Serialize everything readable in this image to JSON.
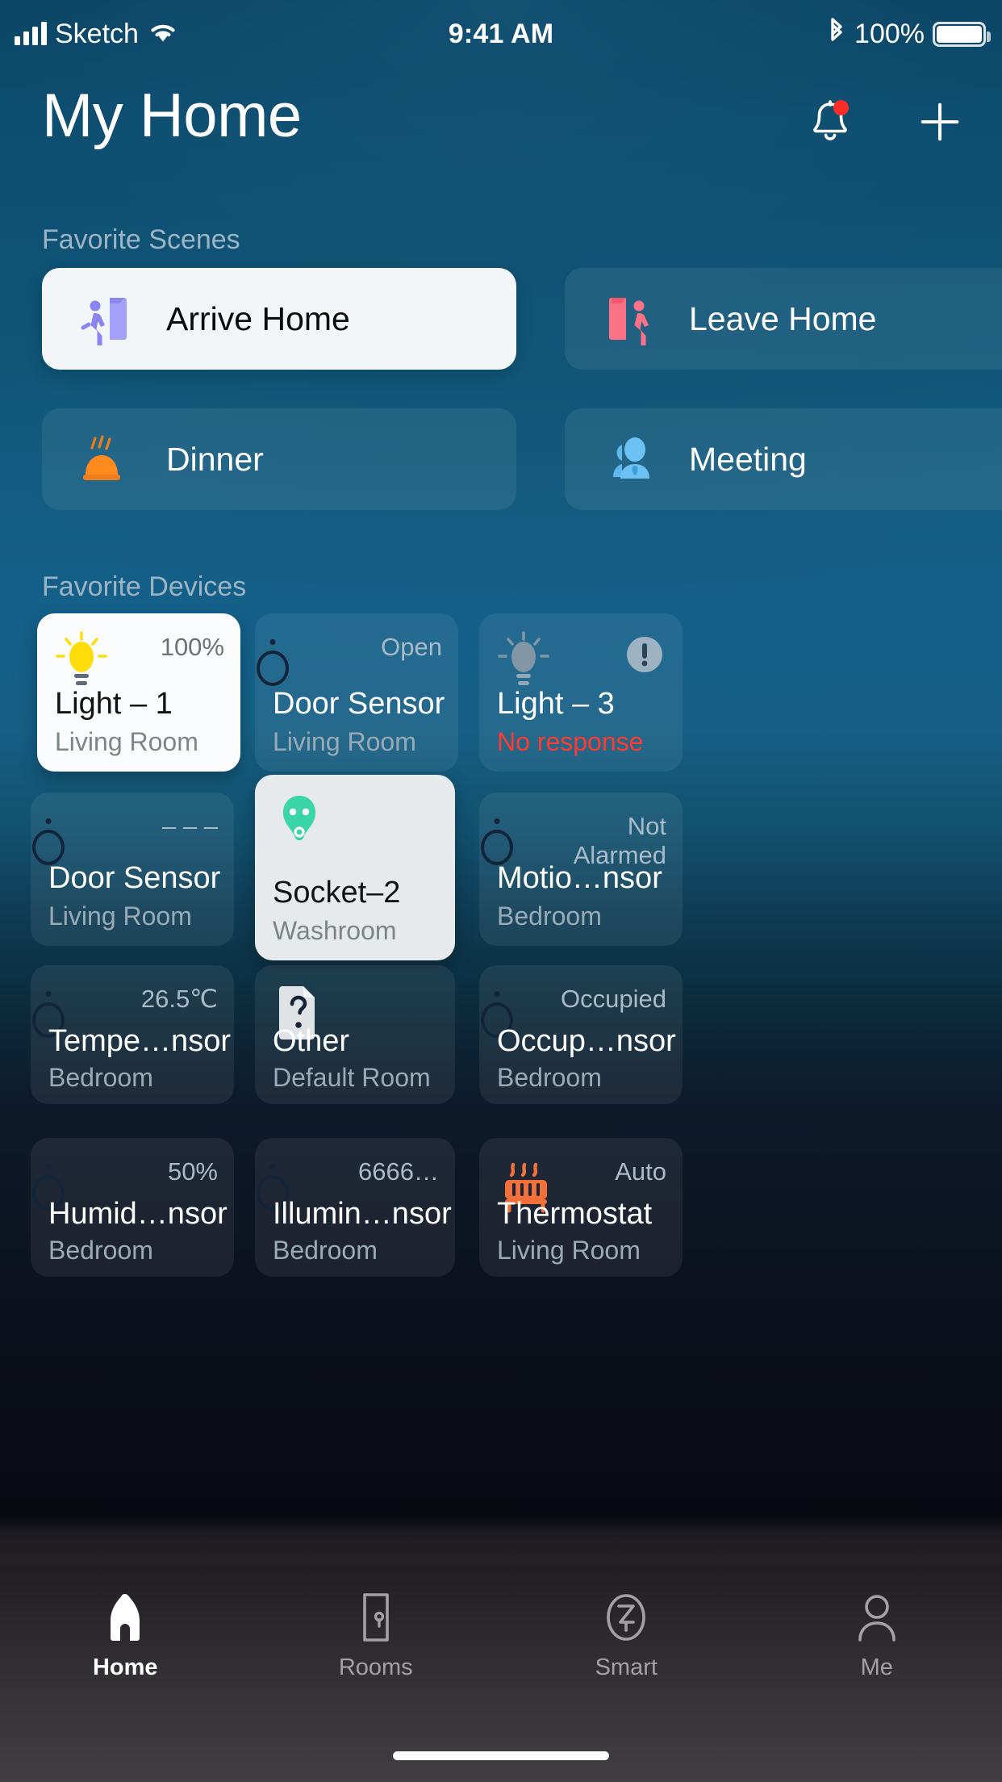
{
  "status_bar": {
    "carrier": "Sketch",
    "time": "9:41 AM",
    "battery_percent": "100%",
    "signal_icon": "signal-bars-icon",
    "wifi_icon": "wifi-icon",
    "bluetooth_icon": "bluetooth-icon",
    "battery_icon": "battery-icon"
  },
  "header": {
    "title": "My Home",
    "notification_icon": "bell-icon",
    "add_icon": "plus-icon",
    "has_notification_badge": true
  },
  "scenes_section": {
    "label": "Favorite Scenes",
    "items": [
      {
        "label": "Arrive Home",
        "icon": "door-enter-icon",
        "icon_color": "#8e8cf5",
        "active": true
      },
      {
        "label": "Leave Home",
        "icon": "door-exit-icon",
        "icon_color": "#fb6b80",
        "active": false
      },
      {
        "label": "Dinner",
        "icon": "food-cloche-icon",
        "icon_color": "#ff8a1e",
        "active": false
      },
      {
        "label": "Meeting",
        "icon": "people-icon",
        "icon_color": "#6cc2f5",
        "active": false
      }
    ]
  },
  "devices_section": {
    "label": "Favorite Devices",
    "items": [
      {
        "name": "Light – 1",
        "room": "Living Room",
        "state": "100%",
        "icon": "lightbulb-on-icon",
        "active": true,
        "alert": false
      },
      {
        "name": "Door Sensor",
        "room": "Living Room",
        "state": "Open",
        "icon": "sensor-icon",
        "active": false,
        "alert": false
      },
      {
        "name": "Light – 3",
        "room": "No response",
        "state": "",
        "icon": "lightbulb-off-icon",
        "active": false,
        "alert": true
      },
      {
        "name": "Door Sensor",
        "room": "Living Room",
        "state": "– – –",
        "icon": "sensor-icon",
        "active": false,
        "alert": false
      },
      {
        "name": "Socket–2",
        "room": "Washroom",
        "state": "",
        "icon": "socket-icon",
        "active": true,
        "alert": false
      },
      {
        "name": "Motio…nsor",
        "room": "Bedroom",
        "state": "Not Alarmed",
        "icon": "sensor-icon",
        "active": false,
        "alert": false
      },
      {
        "name": "Tempe…nsor",
        "room": "Bedroom",
        "state": "26.5℃",
        "icon": "sensor-icon",
        "active": false,
        "alert": false
      },
      {
        "name": "Other",
        "room": "Default Room",
        "state": "",
        "icon": "unknown-device-icon",
        "active": false,
        "alert": false
      },
      {
        "name": "Occup…nsor",
        "room": "Bedroom",
        "state": "Occupied",
        "icon": "sensor-icon",
        "active": false,
        "alert": false
      },
      {
        "name": "Humid…nsor",
        "room": "Bedroom",
        "state": "50%",
        "icon": "sensor-icon",
        "active": false,
        "alert": false
      },
      {
        "name": "Illumin…nsor",
        "room": "Bedroom",
        "state": "6666…",
        "icon": "sensor-icon",
        "active": false,
        "alert": false
      },
      {
        "name": "Thermostat",
        "room": "Living Room",
        "state": "Auto",
        "icon": "radiator-icon",
        "active": false,
        "alert": false
      }
    ]
  },
  "tab_bar": {
    "items": [
      {
        "label": "Home",
        "icon": "home-icon",
        "active": true
      },
      {
        "label": "Rooms",
        "icon": "door-icon",
        "active": false
      },
      {
        "label": "Smart",
        "icon": "automation-icon",
        "active": false
      },
      {
        "label": "Me",
        "icon": "person-icon",
        "active": false
      }
    ]
  },
  "colors": {
    "accent_orange": "#fbbc6b",
    "alert_red": "#ff3b2f",
    "socket_green": "#3ad6a8",
    "bulb_yellow": "#ffdd0b"
  }
}
